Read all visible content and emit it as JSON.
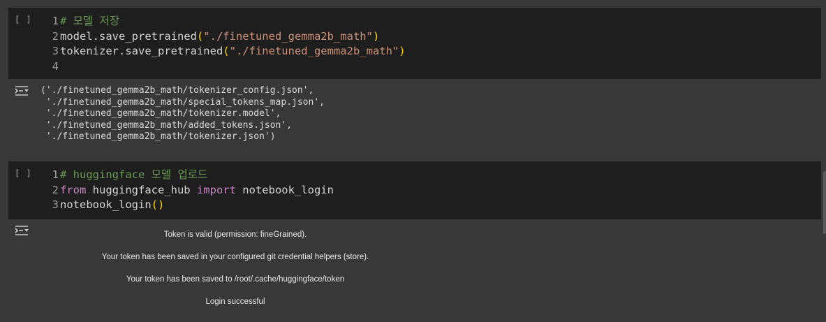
{
  "cells": [
    {
      "run_label": "[ ]",
      "lines": [
        [
          {
            "t": "1",
            "c": "ln"
          },
          {
            "t": "# 모델 저장",
            "c": "t-comment"
          }
        ],
        [
          {
            "t": "2",
            "c": "ln"
          },
          {
            "t": "model.save_pretrained",
            "c": "t-plain"
          },
          {
            "t": "(",
            "c": "t-paren"
          },
          {
            "t": "\"./finetuned_gemma2b_math\"",
            "c": "t-str"
          },
          {
            "t": ")",
            "c": "t-paren"
          }
        ],
        [
          {
            "t": "3",
            "c": "ln"
          },
          {
            "t": "tokenizer.save_pretrained",
            "c": "t-plain"
          },
          {
            "t": "(",
            "c": "t-paren"
          },
          {
            "t": "\"./finetuned_gemma2b_math\"",
            "c": "t-str"
          },
          {
            "t": ")",
            "c": "t-paren"
          }
        ],
        [
          {
            "t": "4",
            "c": "ln"
          }
        ]
      ]
    },
    {
      "run_label": "[ ]",
      "lines": [
        [
          {
            "t": "1",
            "c": "ln"
          },
          {
            "t": "# huggingface 모델 업로드",
            "c": "t-comment"
          }
        ],
        [
          {
            "t": "2",
            "c": "ln"
          },
          {
            "t": "from",
            "c": "t-kw"
          },
          {
            "t": " huggingface_hub ",
            "c": "t-plain"
          },
          {
            "t": "import",
            "c": "t-kw"
          },
          {
            "t": " notebook_login",
            "c": "t-plain"
          }
        ],
        [
          {
            "t": "3",
            "c": "ln"
          },
          {
            "t": "notebook_login",
            "c": "t-plain"
          },
          {
            "t": "()",
            "c": "t-paren"
          }
        ]
      ]
    }
  ],
  "output1": "('./finetuned_gemma2b_math/tokenizer_config.json',\n './finetuned_gemma2b_math/special_tokens_map.json',\n './finetuned_gemma2b_math/tokenizer.model',\n './finetuned_gemma2b_math/added_tokens.json',\n './finetuned_gemma2b_math/tokenizer.json')",
  "output2": {
    "line1": "Token is valid (permission: fineGrained).",
    "line2": "Your token has been saved in your configured git credential helpers (store).",
    "line3": "Your token has been saved to /root/.cache/huggingface/token",
    "line4": "Login successful"
  },
  "icons": {
    "output_toggle": "output-collapse-icon",
    "run": "run-cell-button"
  },
  "colors": {
    "background": "#383838",
    "cell_background": "#1e1e1e",
    "comment": "#6a9955",
    "string": "#ce9178",
    "keyword": "#c586c0",
    "paren": "#ffd700"
  }
}
